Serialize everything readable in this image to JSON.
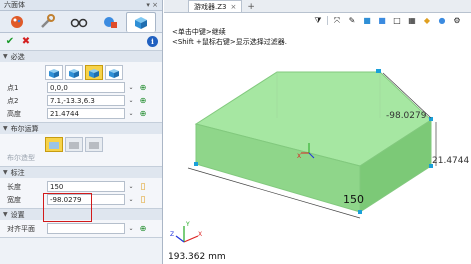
{
  "panel": {
    "title": "六面体",
    "pin": "▾ ×"
  },
  "sections": {
    "required": "必选",
    "boolean": "布尔运算",
    "boolean_disabled": "布尔造型",
    "annotation": "标注",
    "settings": "设置"
  },
  "fields": {
    "point1_label": "点1",
    "point1_value": "0,0,0",
    "point2_label": "点2",
    "point2_value": "7.1,-13.3,6.3",
    "height_label": "高度",
    "height_value": "21.4744",
    "length_label": "长度",
    "length_value": "150",
    "width_label": "宽度",
    "width_value": "-98.0279",
    "align_label": "对齐平面"
  },
  "viewport": {
    "tab_title": "游戏器.Z3",
    "tab_close": "×",
    "tab_add": "+",
    "hint1": "<单击中键>继续",
    "hint2": "<Shift +鼠标右键>显示选择过滤器.",
    "dim_length": "150",
    "dim_width": "-98.0279",
    "dim_height": "21.4744",
    "status": "193.362 mm"
  },
  "colors": {
    "box_fill": "#9ee39a",
    "box_edge": "#7ec47a",
    "highlight": "#d21a1a",
    "accent": "#f7d34a"
  }
}
